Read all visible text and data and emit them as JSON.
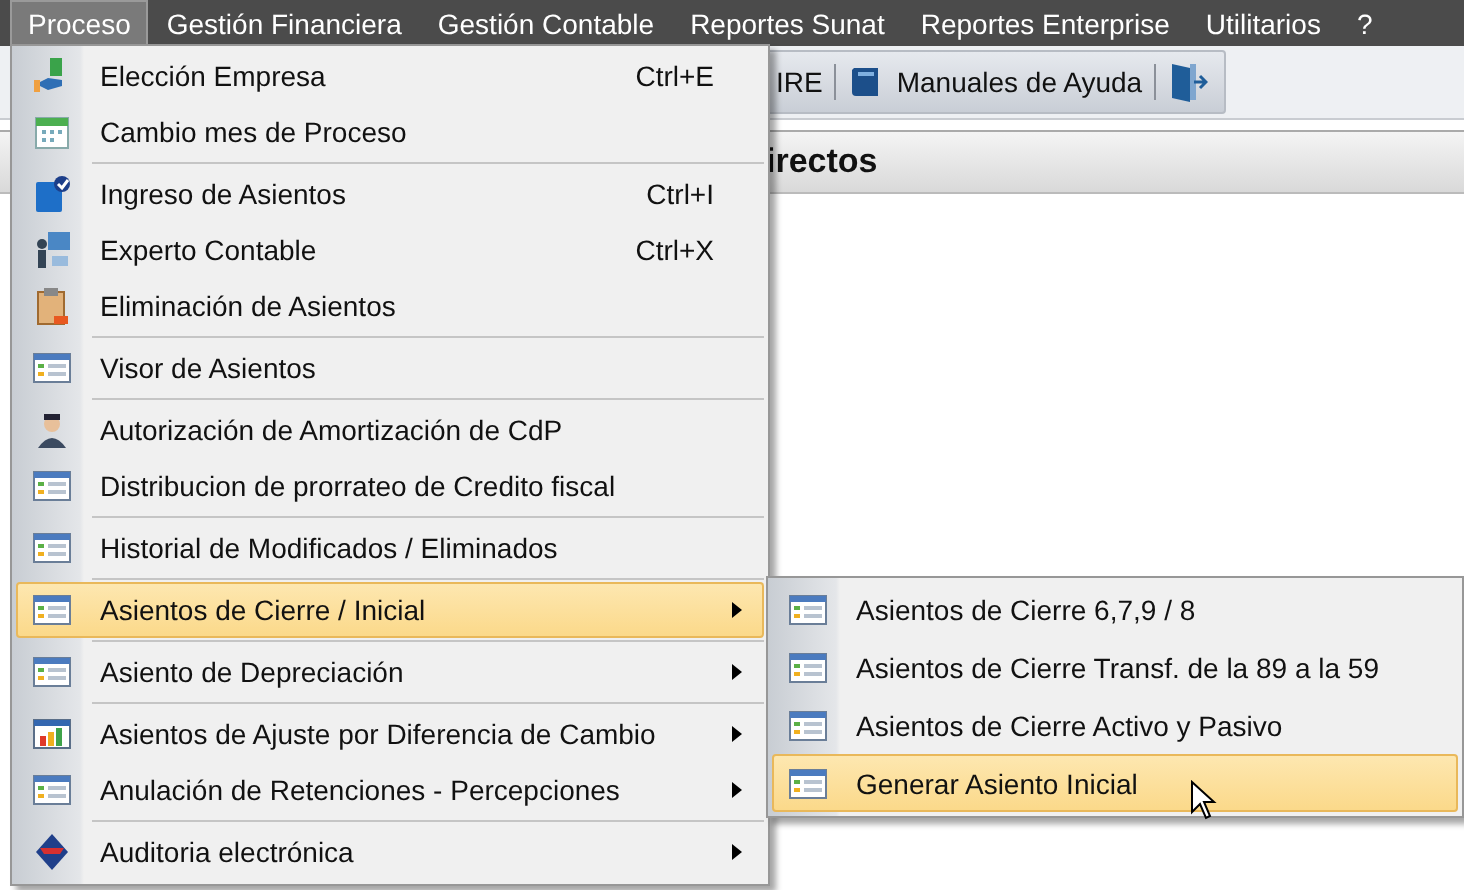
{
  "menubar": [
    {
      "label": "Proceso",
      "selected": true
    },
    {
      "label": "Gestión Financiera",
      "selected": false
    },
    {
      "label": "Gestión Contable",
      "selected": false
    },
    {
      "label": "Reportes Sunat",
      "selected": false
    },
    {
      "label": "Reportes Enterprise",
      "selected": false
    },
    {
      "label": "Utilitarios",
      "selected": false
    },
    {
      "label": "?",
      "selected": false
    }
  ],
  "toolbar": [
    {
      "kind": "text",
      "label": "IRE"
    },
    {
      "kind": "book",
      "label": "Manuales de Ayuda"
    },
    {
      "kind": "exit"
    }
  ],
  "panel": {
    "title": "irectos"
  },
  "menu": {
    "groups": [
      [
        {
          "label": "Elección Empresa",
          "shortcut": "Ctrl+E",
          "kind": "company",
          "submenu": false,
          "selected": false
        },
        {
          "label": "Cambio mes de Proceso",
          "kind": "calendar",
          "submenu": false,
          "selected": false
        }
      ],
      [
        {
          "label": "Ingreso de Asientos",
          "shortcut": "Ctrl+I",
          "kind": "entry",
          "submenu": false,
          "selected": false
        },
        {
          "label": "Experto Contable",
          "shortcut": "Ctrl+X",
          "kind": "expert",
          "submenu": false,
          "selected": false
        },
        {
          "label": "Eliminación de Asientos",
          "kind": "clipboard",
          "submenu": false,
          "selected": false
        }
      ],
      [
        {
          "label": "Visor de Asientos",
          "kind": "list",
          "submenu": false,
          "selected": false
        }
      ],
      [
        {
          "label": "Autorización de Amortización de CdP",
          "kind": "person",
          "submenu": false,
          "selected": false
        },
        {
          "label": "Distribucion de prorrateo de Credito fiscal",
          "kind": "list",
          "submenu": false,
          "selected": false
        }
      ],
      [
        {
          "label": "Historial de Modificados / Eliminados",
          "kind": "list",
          "submenu": false,
          "selected": false
        }
      ],
      [
        {
          "label": "Asientos de Cierre / Inicial",
          "kind": "list",
          "submenu": true,
          "selected": true
        }
      ],
      [
        {
          "label": "Asiento de Depreciación",
          "kind": "list",
          "submenu": true,
          "selected": false
        }
      ],
      [
        {
          "label": "Asientos de Ajuste por Diferencia de Cambio",
          "kind": "chart",
          "submenu": true,
          "selected": false
        },
        {
          "label": "Anulación de Retenciones - Percepciones",
          "kind": "list",
          "submenu": true,
          "selected": false
        }
      ],
      [
        {
          "label": "Auditoria electrónica",
          "kind": "audit",
          "submenu": true,
          "selected": false
        }
      ]
    ]
  },
  "submenu": {
    "items": [
      {
        "label": "Asientos de Cierre 6,7,9 / 8",
        "kind": "list",
        "selected": false
      },
      {
        "label": "Asientos de Cierre Transf. de la 89 a la 59",
        "kind": "list",
        "selected": false
      },
      {
        "label": "Asientos de Cierre Activo y Pasivo",
        "kind": "list",
        "selected": false
      },
      {
        "label": "Generar Asiento Inicial",
        "kind": "list",
        "selected": true
      }
    ]
  }
}
